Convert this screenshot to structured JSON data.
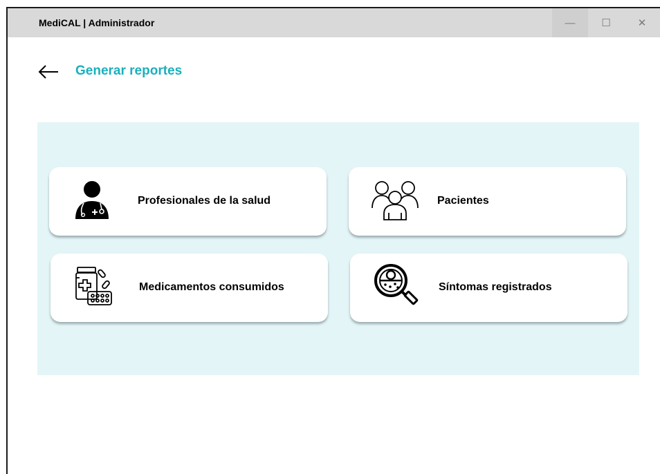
{
  "window": {
    "title": "MediCAL | Administrador",
    "controls": {
      "minimize": "—",
      "maximize": "☐",
      "close": "✕"
    }
  },
  "header": {
    "back_icon": "arrow-left-icon",
    "title": "Generar reportes"
  },
  "reports": [
    {
      "label": "Profesionales de la salud",
      "icon": "doctor-icon"
    },
    {
      "label": "Pacientes",
      "icon": "patients-icon"
    },
    {
      "label": "Medicamentos consumidos",
      "icon": "medicine-icon"
    },
    {
      "label": "Síntomas registrados",
      "icon": "virus-search-icon"
    }
  ],
  "colors": {
    "accent": "#1ab0bd",
    "panel_bg": "#e3f5f7",
    "titlebar_bg": "#d9d9d9"
  }
}
